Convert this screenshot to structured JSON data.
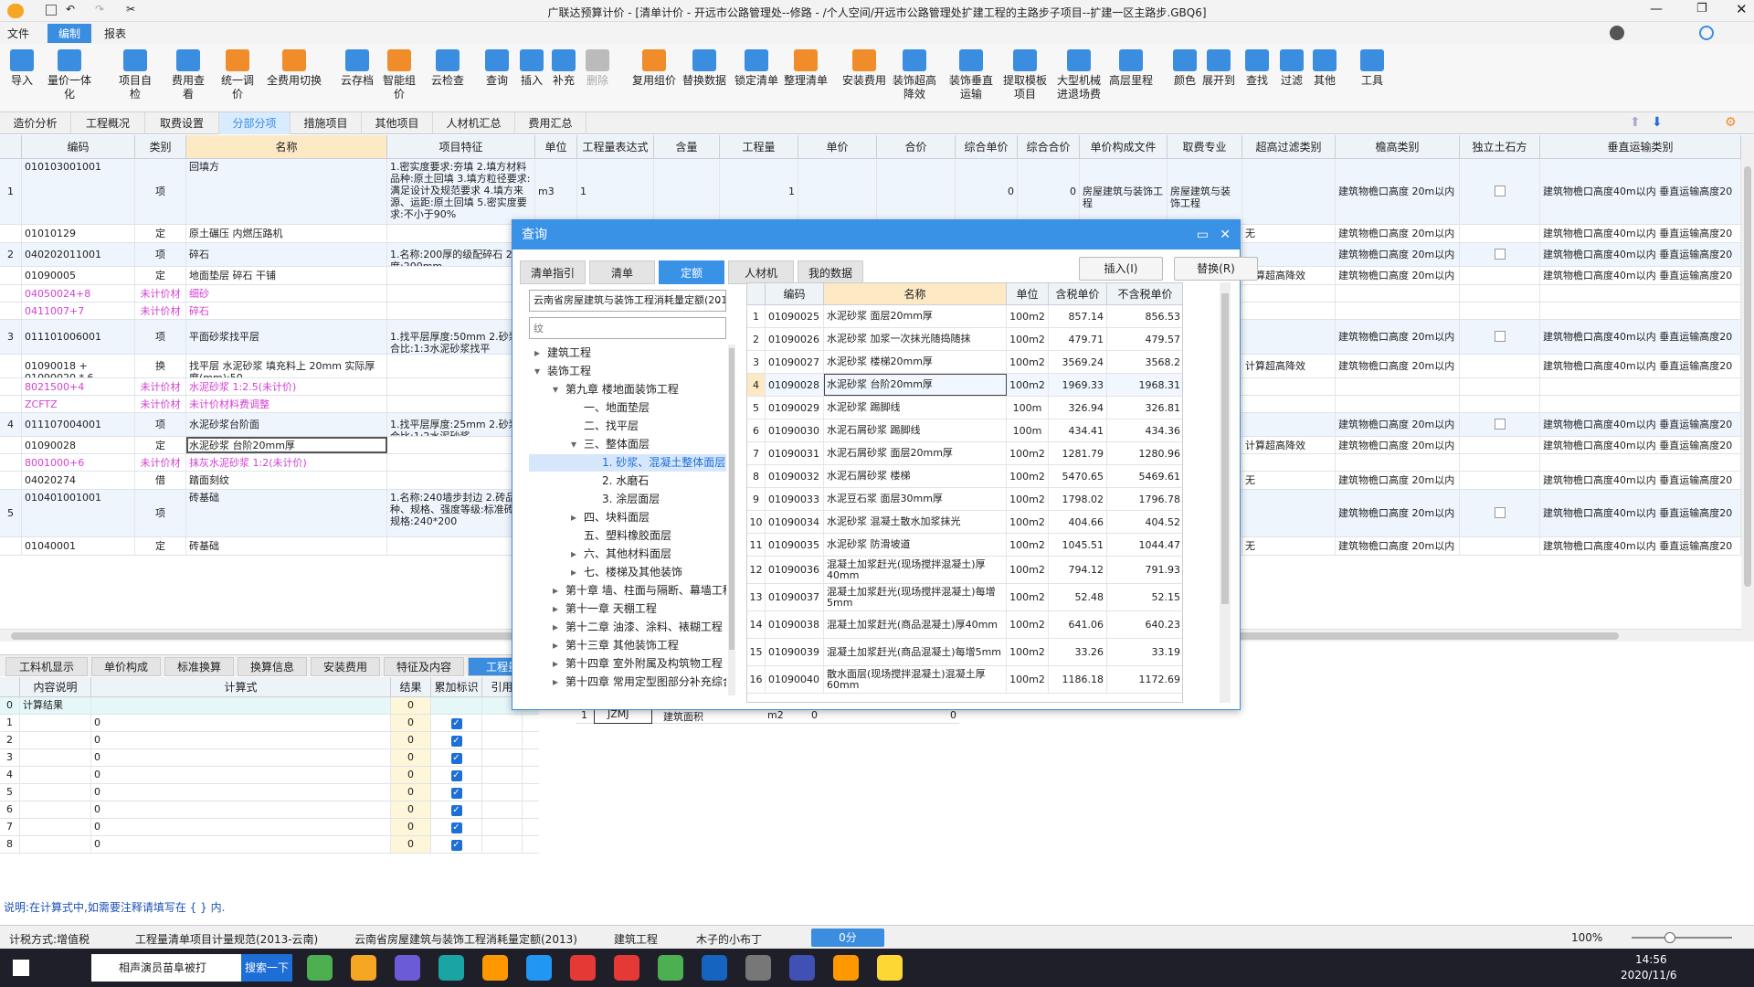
{
  "window": {
    "title": "广联达预算计价 - [清单计价 - 开远市公路管理处--修路 - /个人空间/开远市公路管理处扩建工程的主路步子项目--扩建一区主路步.GBQ6]"
  },
  "menu": [
    "文件",
    "编制",
    "报表"
  ],
  "ribbon": [
    "导入",
    "量价一体化",
    "项目自检",
    "费用查看",
    "统一调价",
    "全费用切换",
    "云存档",
    "智能组价",
    "云检查",
    "查询",
    "插入",
    "补充",
    "删除",
    "复用组价",
    "替换数据",
    "锁定清单",
    "整理清单",
    "安装费用",
    "装饰超高降效",
    "装饰垂直运输",
    "提取模板项目",
    "大型机械进退场费",
    "高层里程",
    "颜色",
    "展开到",
    "查找",
    "过滤",
    "其他",
    "工具"
  ],
  "tabs": [
    "造价分析",
    "工程概况",
    "取费设置",
    "分部分项",
    "措施项目",
    "其他项目",
    "人材机汇总",
    "费用汇总"
  ],
  "grid": {
    "headers": [
      "编码",
      "类别",
      "名称",
      "项目特征",
      "单位",
      "工程量表达式",
      "含量",
      "工程量",
      "单价",
      "合价",
      "综合单价",
      "综合合价",
      "单价构成文件",
      "取费专业",
      "超高过滤类别",
      "檐高类别",
      "独立土石方",
      "垂直运输类别"
    ],
    "rows": [
      {
        "no": "1",
        "code": "010103001001",
        "type": "项",
        "name": "回填方",
        "feature": "1.密实度要求:夯填 2.填方材料品种:原土回填 3.填方粒径要求:满足设计及规范要求 4.填方来源、运距:原土回填 5.密实度要求:不小于90%",
        "unit": "m3",
        "expr": "1",
        "qty": "1",
        "zhdj": "0",
        "zhhj": "0",
        "djgc": "房屋建筑与装饰工程",
        "qfzy": "房屋建筑与装饰工程",
        "cg": "",
        "yg": "建筑物檐口高度 20m以内",
        "cb": true,
        "cz": "建筑物檐口高度40m以内 垂直运输高度20"
      },
      {
        "no": "",
        "code": "01010129",
        "type": "定",
        "name": "原土碾压 内燃压路机",
        "feature": "",
        "unit": "",
        "expr": "",
        "qty": "",
        "zhdj": "",
        "zhhj": "",
        "djgc": "",
        "qfzy": "",
        "cg": "无",
        "yg": "建筑物檐口高度 20m以内",
        "cb": false,
        "cz": "建筑物檐口高度40m以内 垂直运输高度20"
      },
      {
        "no": "2",
        "code": "040202011001",
        "type": "项",
        "name": "碎石",
        "feature": "1.名称:200厚的级配碎石 2.厚度:200mm",
        "unit": "",
        "expr": "",
        "qty": "",
        "zhdj": "",
        "zhhj": "",
        "djgc": "",
        "qfzy": "",
        "cg": "",
        "yg": "建筑物檐口高度 20m以内",
        "cb": true,
        "cz": "建筑物檐口高度40m以内 垂直运输高度20"
      },
      {
        "no": "",
        "code": "01090005",
        "type": "定",
        "name": "地面垫层 碎石 干铺",
        "feature": "",
        "unit": "",
        "expr": "",
        "qty": "",
        "zhdj": "",
        "zhhj": "",
        "djgc": "",
        "qfzy": "",
        "cg": "计算超高降效",
        "yg": "建筑物檐口高度 20m以内",
        "cb": false,
        "cz": "建筑物檐口高度40m以内 垂直运输高度20"
      },
      {
        "no": "",
        "code": "04050024+8",
        "type": "未计价材",
        "name": "细砂",
        "feature": "",
        "mag": true
      },
      {
        "no": "",
        "code": "0411007+7",
        "type": "未计价材",
        "name": "碎石",
        "feature": "",
        "mag": true
      },
      {
        "no": "3",
        "code": "011101006001",
        "type": "项",
        "name": "平面砂浆找平层",
        "feature": "1.找平层厚度:50mm 2.砂浆配合比:1:3水泥砂浆找平",
        "unit": "",
        "expr": "",
        "qty": "",
        "zhdj": "",
        "zhhj": "",
        "djgc": "",
        "qfzy": "",
        "cg": "",
        "yg": "建筑物檐口高度 20m以内",
        "cb": true,
        "cz": "建筑物檐口高度40m以内 垂直运输高度20"
      },
      {
        "no": "",
        "code": "01090018 + 01090020 * 6",
        "type": "换",
        "name": "找平层 水泥砂浆 填充料上 20mm 实际厚度(mm):50",
        "feature": "",
        "unit": "",
        "expr": "",
        "qty": "",
        "zhdj": "",
        "zhhj": "",
        "djgc": "",
        "qfzy": "",
        "cg": "计算超高降效",
        "yg": "建筑物檐口高度 20m以内",
        "cb": false,
        "cz": "建筑物檐口高度40m以内 垂直运输高度20"
      },
      {
        "no": "",
        "code": "8021500+4",
        "type": "未计价材",
        "name": "水泥砂浆 1:2.5(未计价)",
        "feature": "",
        "mag": true
      },
      {
        "no": "",
        "code": "ZCFTZ",
        "type": "未计价材",
        "name": "未计价材料费调整",
        "feature": "",
        "mag": true
      },
      {
        "no": "4",
        "code": "011107004001",
        "type": "项",
        "name": "水泥砂浆台阶面",
        "feature": "1.找平层厚度:25mm 2.砂浆配合比:1:2水泥砂浆",
        "unit": "",
        "expr": "",
        "qty": "",
        "zhdj": "",
        "zhhj": "",
        "djgc": "",
        "qfzy": "",
        "cg": "",
        "yg": "建筑物檐口高度 20m以内",
        "cb": true,
        "cz": "建筑物檐口高度40m以内 垂直运输高度20"
      },
      {
        "no": "",
        "code": "01090028",
        "type": "定",
        "name": "水泥砂浆 台阶20mm厚",
        "feature": "",
        "unit": "",
        "expr": "",
        "qty": "",
        "zhdj": "",
        "zhhj": "",
        "djgc": "",
        "qfzy": "",
        "cg": "计算超高降效",
        "yg": "建筑物檐口高度 20m以内",
        "cb": false,
        "cz": "建筑物檐口高度40m以内 垂直运输高度20"
      },
      {
        "no": "",
        "code": "8001000+6",
        "type": "未计价材",
        "name": "抹灰水泥砂浆 1:2(未计价)",
        "feature": "",
        "mag": true
      },
      {
        "no": "",
        "code": "04020274",
        "type": "借",
        "name": "踏面刻纹",
        "feature": "",
        "unit": "",
        "expr": "",
        "qty": "",
        "zhdj": "",
        "zhhj": "",
        "djgc": "",
        "qfzy": "",
        "cg": "无",
        "yg": "建筑物檐口高度 20m以内",
        "cb": false,
        "cz": "建筑物檐口高度40m以内 垂直运输高度20"
      },
      {
        "no": "5",
        "code": "010401001001",
        "type": "项",
        "name": "砖基础",
        "feature": "1.名称:240墙步封边 2.砖品种、规格、强度等级:标准砖 3.规格:240*200",
        "unit": "",
        "expr": "",
        "qty": "",
        "zhdj": "",
        "zhhj": "",
        "djgc": "",
        "qfzy": "",
        "cg": "",
        "yg": "建筑物檐口高度 20m以内",
        "cb": true,
        "cz": "建筑物檐口高度40m以内 垂直运输高度20"
      },
      {
        "no": "",
        "code": "01040001",
        "type": "定",
        "name": "砖基础",
        "feature": "",
        "unit": "",
        "expr": "",
        "qty": "",
        "zhdj": "",
        "zhhj": "",
        "djgc": "",
        "qfzy": "",
        "cg": "无",
        "yg": "建筑物檐口高度 20m以内",
        "cb": false,
        "cz": "建筑物檐口高度40m以内 垂直运输高度20"
      }
    ]
  },
  "bottom_tabs": [
    "工料机显示",
    "单价构成",
    "标准换算",
    "换算信息",
    "安装费用",
    "特征及内容",
    "工程量"
  ],
  "bottom_grid": {
    "headers": [
      "内容说明",
      "计算式",
      "结果",
      "累加标识",
      "引用"
    ],
    "rows": [
      {
        "no": "0",
        "desc": "计算结果",
        "formula": "",
        "result": "0",
        "check": false
      },
      {
        "no": "1",
        "desc": "",
        "formula": "0",
        "result": "0",
        "check": true
      },
      {
        "no": "2",
        "desc": "",
        "formula": "0",
        "result": "0",
        "check": true
      },
      {
        "no": "3",
        "desc": "",
        "formula": "0",
        "result": "0",
        "check": true
      },
      {
        "no": "4",
        "desc": "",
        "formula": "0",
        "result": "0",
        "check": true
      },
      {
        "no": "5",
        "desc": "",
        "formula": "0",
        "result": "0",
        "check": true
      },
      {
        "no": "6",
        "desc": "",
        "formula": "0",
        "result": "0",
        "check": true
      },
      {
        "no": "7",
        "desc": "",
        "formula": "0",
        "result": "0",
        "check": true
      },
      {
        "no": "8",
        "desc": "",
        "formula": "0",
        "result": "0",
        "check": true
      }
    ]
  },
  "hint": "说明:在计算式中,如需要注释请填写在 { } 内.",
  "under_dialog_row": {
    "no": "1",
    "code": "JZMJ",
    "name": "建筑面积",
    "unit": "m2",
    "a": "0",
    "b": "0"
  },
  "status": {
    "items": [
      "计税方式:增值税",
      "工程量清单项目计量规范(2013-云南)",
      "云南省房屋建筑与装饰工程消耗量定额(2013)",
      "建筑工程",
      "木子的小布丁"
    ],
    "badge": "0分",
    "zoom": "100%"
  },
  "taskbar": {
    "search_app": "相声演员苗阜被打",
    "search_btn": "搜索一下",
    "time": "14:56",
    "date": "2020/11/6"
  },
  "dialog": {
    "title": "查询",
    "tabs": [
      "清单指引",
      "清单",
      "定额",
      "人材机",
      "我的数据"
    ],
    "insert_btn": "插入(I)",
    "replace_btn": "替换(R)",
    "library": "云南省房屋建筑与装饰工程消耗量定额(2013)",
    "search_placeholder": "纹",
    "tree": [
      "建筑工程",
      "装饰工程",
      "第九章 楼地面装饰工程",
      "一、地面垫层",
      "二、找平层",
      "三、整体面层",
      "1. 砂浆、混凝土整体面层",
      "2. 水磨石",
      "3. 涂层面层",
      "四、块料面层",
      "五、塑料橡胶面层",
      "六、其他材料面层",
      "七、楼梯及其他装饰",
      "第十章 墙、柱面与隔断、幕墙工程",
      "第十一章 天棚工程",
      "第十二章 油漆、涂料、裱糊工程",
      "第十三章 其他装饰工程",
      "第十四章 室外附属及构筑物工程",
      "第十四章 常用定型图部分补充综合定额"
    ],
    "headers": [
      "编码",
      "名称",
      "单位",
      "含税单价",
      "不含税单价"
    ],
    "rows": [
      {
        "no": "1",
        "code": "01090025",
        "name": "水泥砂浆 面层20mm厚",
        "unit": "100m2",
        "tax": "857.14",
        "notax": "856.53"
      },
      {
        "no": "2",
        "code": "01090026",
        "name": "水泥砂浆 加浆一次抹光随捣随抹",
        "unit": "100m2",
        "tax": "479.71",
        "notax": "479.57"
      },
      {
        "no": "3",
        "code": "01090027",
        "name": "水泥砂浆 楼梯20mm厚",
        "unit": "100m2",
        "tax": "3569.24",
        "notax": "3568.2"
      },
      {
        "no": "4",
        "code": "01090028",
        "name": "水泥砂浆 台阶20mm厚",
        "unit": "100m2",
        "tax": "1969.33",
        "notax": "1968.31"
      },
      {
        "no": "5",
        "code": "01090029",
        "name": "水泥砂浆 踢脚线",
        "unit": "100m",
        "tax": "326.94",
        "notax": "326.81"
      },
      {
        "no": "6",
        "code": "01090030",
        "name": "水泥石屑砂浆 踢脚线",
        "unit": "100m",
        "tax": "434.41",
        "notax": "434.36"
      },
      {
        "no": "7",
        "code": "01090031",
        "name": "水泥石屑砂浆 面层20mm厚",
        "unit": "100m2",
        "tax": "1281.79",
        "notax": "1280.96"
      },
      {
        "no": "8",
        "code": "01090032",
        "name": "水泥石屑砂浆 楼梯",
        "unit": "100m2",
        "tax": "5470.65",
        "notax": "5469.61"
      },
      {
        "no": "9",
        "code": "01090033",
        "name": "水泥豆石浆 面层30mm厚",
        "unit": "100m2",
        "tax": "1798.02",
        "notax": "1796.78"
      },
      {
        "no": "10",
        "code": "01090034",
        "name": "水泥砂浆 混凝土散水加浆抹光",
        "unit": "100m2",
        "tax": "404.66",
        "notax": "404.52"
      },
      {
        "no": "11",
        "code": "01090035",
        "name": "水泥砂浆 防滑坡道",
        "unit": "100m2",
        "tax": "1045.51",
        "notax": "1044.47"
      },
      {
        "no": "12",
        "code": "01090036",
        "name": "混凝土加浆赶光(现场搅拌混凝土)厚40mm",
        "unit": "100m2",
        "tax": "794.12",
        "notax": "791.93"
      },
      {
        "no": "13",
        "code": "01090037",
        "name": "混凝土加浆赶光(现场搅拌混凝土)每增5mm",
        "unit": "100m2",
        "tax": "52.48",
        "notax": "52.15"
      },
      {
        "no": "14",
        "code": "01090038",
        "name": "混凝土加浆赶光(商品混凝土)厚40mm",
        "unit": "100m2",
        "tax": "641.06",
        "notax": "640.23"
      },
      {
        "no": "15",
        "code": "01090039",
        "name": "混凝土加浆赶光(商品混凝土)每增5mm",
        "unit": "100m2",
        "tax": "33.26",
        "notax": "33.19"
      },
      {
        "no": "16",
        "code": "01090040",
        "name": "散水面层(现场搅拌混凝土)混凝土厚60mm",
        "unit": "100m2",
        "tax": "1186.18",
        "notax": "1172.69"
      }
    ]
  }
}
